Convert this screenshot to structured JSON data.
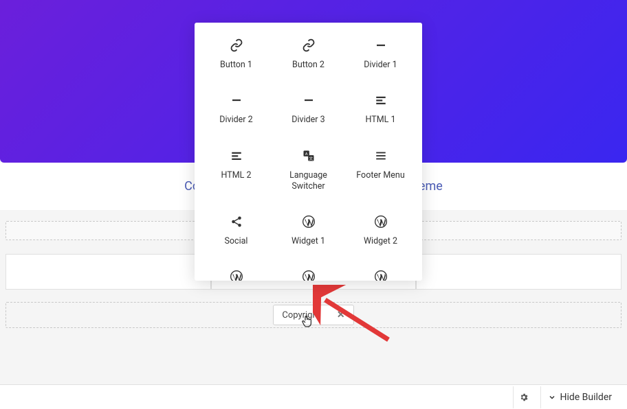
{
  "hero": {},
  "footer": {
    "text": "Copyright © 2023 hioned-                                          ra WordPress Theme"
  },
  "popover": {
    "elements": [
      {
        "label": "Button 1",
        "icon": "link"
      },
      {
        "label": "Button 2",
        "icon": "link"
      },
      {
        "label": "Divider 1",
        "icon": "minus"
      },
      {
        "label": "Divider 2",
        "icon": "minus"
      },
      {
        "label": "Divider 3",
        "icon": "minus"
      },
      {
        "label": "HTML 1",
        "icon": "html"
      },
      {
        "label": "HTML 2",
        "icon": "html"
      },
      {
        "label": "Language Switcher",
        "icon": "language"
      },
      {
        "label": "Footer Menu",
        "icon": "menu"
      },
      {
        "label": "Social",
        "icon": "share"
      },
      {
        "label": "Widget 1",
        "icon": "wp"
      },
      {
        "label": "Widget 2",
        "icon": "wp"
      },
      {
        "label": "",
        "icon": "wp"
      },
      {
        "label": "",
        "icon": "wp"
      },
      {
        "label": "",
        "icon": "wp"
      }
    ]
  },
  "chip": {
    "label": "Copyright"
  },
  "bottom": {
    "hide_builder": "Hide Builder"
  },
  "plus": "+"
}
